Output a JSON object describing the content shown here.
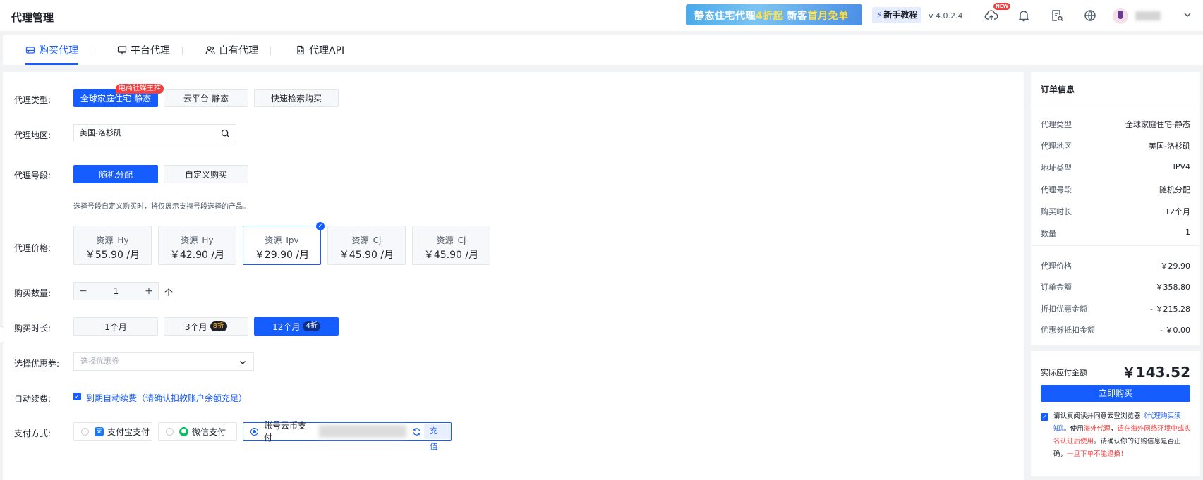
{
  "header": {
    "title": "代理管理",
    "banner_a": "静态住宅代理",
    "banner_b": "4折起",
    "banner_c": " 新客",
    "banner_d": "首月免单",
    "newbie": "新手教程",
    "version": "v 4.0.2.4",
    "new_badge": "NEW"
  },
  "tabs": [
    "购买代理",
    "平台代理",
    "自有代理",
    "代理API"
  ],
  "form": {
    "type_label": "代理类型:",
    "types": [
      "全球家庭住宅-静态",
      "云平台-静态",
      "快速检索购买"
    ],
    "type_badge": "电商社媒主推",
    "region_label": "代理地区:",
    "region_value": "美国-洛杉矶",
    "segment_label": "代理号段:",
    "segments": [
      "随机分配",
      "自定义购买"
    ],
    "segment_note": "选择号段自定义购买时，将仅展示支持号段选择的产品。",
    "price_label": "代理价格:",
    "prices": [
      {
        "name": "资源_Hy",
        "price": "￥55.90 /月"
      },
      {
        "name": "资源_Hy",
        "price": "￥42.90 /月"
      },
      {
        "name": "资源_Ipv",
        "price": "￥29.90 /月"
      },
      {
        "name": "资源_Cj",
        "price": "￥45.90 /月"
      },
      {
        "name": "资源_Cj",
        "price": "￥45.90 /月"
      }
    ],
    "selected_price": 2,
    "qty_label": "购买数量:",
    "qty_minus": "−",
    "qty_value": "1",
    "qty_plus": "+",
    "qty_unit": "个",
    "duration_label": "购买时长:",
    "durations": [
      {
        "label": "1个月",
        "discount": ""
      },
      {
        "label": "3个月",
        "discount": "8折"
      },
      {
        "label": "12个月",
        "discount": "4折"
      }
    ],
    "coupon_label": "选择优惠券:",
    "coupon_placeholder": "选择优惠券",
    "auto_label": "自动续费:",
    "auto_text": "到期自动续费（请确认扣款账户余额充足）",
    "pay_label": "支付方式:",
    "pay_methods": [
      "支付宝支付",
      "微信支付",
      "账号云币支付"
    ],
    "recharge": "充值"
  },
  "order": {
    "title": "订单信息",
    "rows": [
      {
        "k": "代理类型",
        "v": "全球家庭住宅-静态"
      },
      {
        "k": "代理地区",
        "v": "美国-洛杉矶"
      },
      {
        "k": "地址类型",
        "v": "IPV4"
      },
      {
        "k": "代理号段",
        "v": "随机分配"
      },
      {
        "k": "购买时长",
        "v": "12个月"
      },
      {
        "k": "数量",
        "v": "1"
      }
    ],
    "amounts": [
      {
        "k": "代理价格",
        "v": "￥29.90"
      },
      {
        "k": "订单金额",
        "v": "￥358.80"
      },
      {
        "k": "折扣优惠金额",
        "v": "- ￥215.28"
      },
      {
        "k": "优惠券抵扣金额",
        "v": "- ￥0.00"
      }
    ],
    "pay_label": "实际应付金额",
    "pay_value": "￥143.52",
    "buy": "立即购买",
    "terms_1": "请认真阅读并同意云登浏览器",
    "terms_2": "《代理购买须知》",
    "terms_3": "。使用",
    "terms_4": "海外代理",
    "terms_5": "，",
    "terms_6": "请在海外网络环境中或实名认证后使用",
    "terms_7": "。请确认你的订购信息是否正确，",
    "terms_8": "一旦下单不能退换！"
  },
  "colors": {
    "accent": "#165dff",
    "danger": "#f53f3f"
  }
}
